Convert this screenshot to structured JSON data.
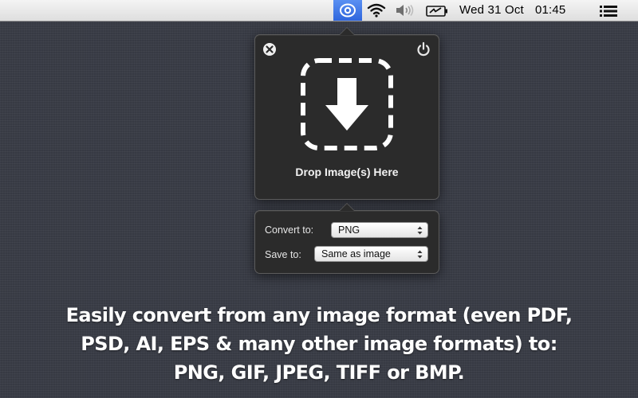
{
  "menubar": {
    "app_icon": "eye-icon",
    "wifi_icon": "wifi-icon",
    "volume_icon": "speaker-icon",
    "battery_icon": "battery-charging-icon",
    "clock_day": "Wed 31 Oct",
    "clock_time": "01:45",
    "list_icon": "notification-list-icon",
    "accent_color": "#3d75e6"
  },
  "drop_popover": {
    "close_icon": "close-icon",
    "power_icon": "power-icon",
    "drop_icon": "download-arrow-icon",
    "label": "Drop Image(s) Here"
  },
  "settings_popover": {
    "convert_label": "Convert to:",
    "convert_value": "PNG",
    "save_label": "Save to:",
    "save_value": "Same as image"
  },
  "caption": {
    "line1": "Easily convert from any image format (even PDF,",
    "line2": "PSD, AI, EPS & many other image formats) to:",
    "line3": "PNG, GIF, JPEG, TIFF or BMP."
  }
}
